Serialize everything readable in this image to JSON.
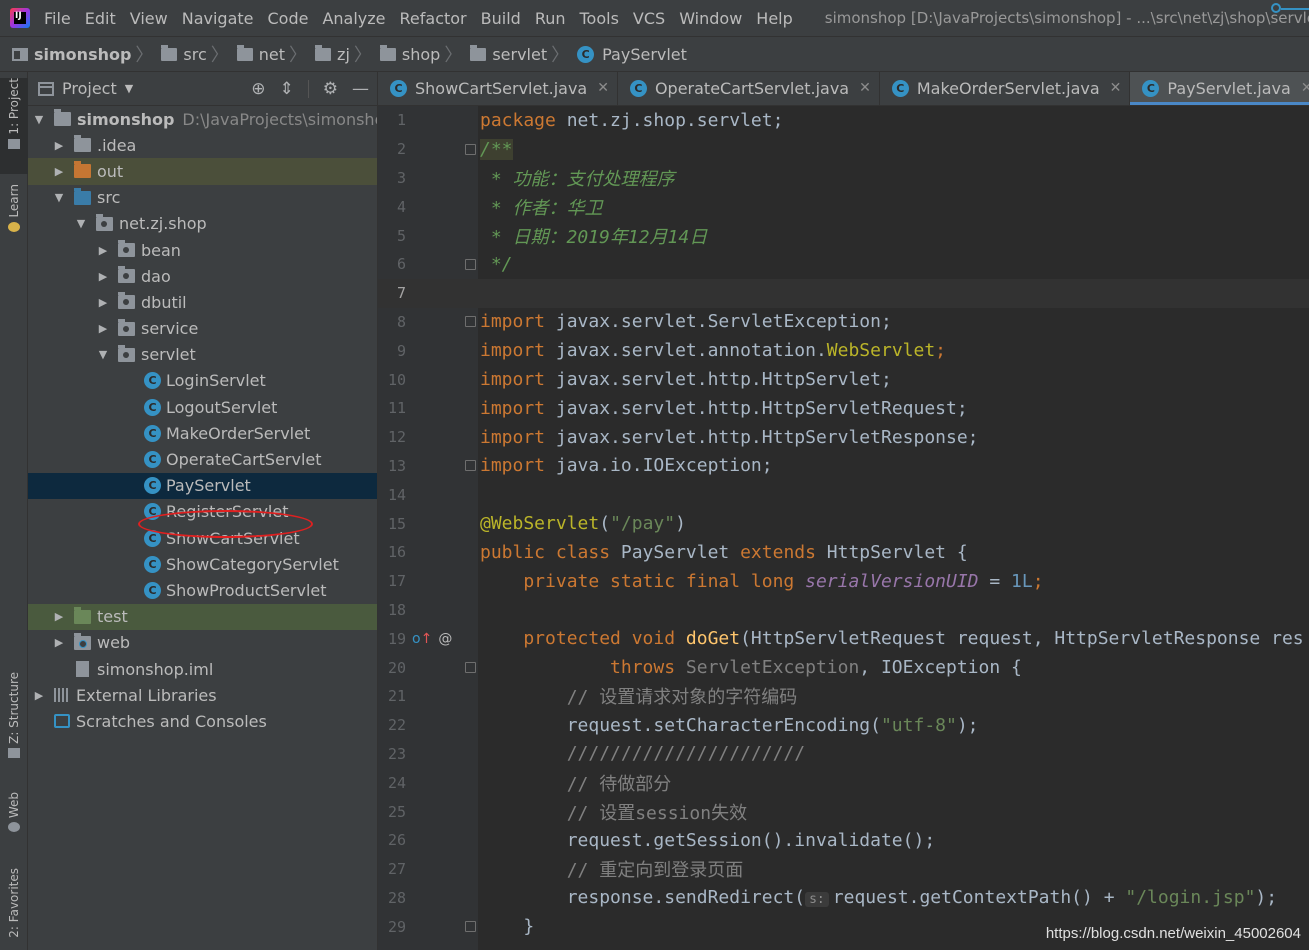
{
  "menu": {
    "items": [
      "File",
      "Edit",
      "View",
      "Navigate",
      "Code",
      "Analyze",
      "Refactor",
      "Build",
      "Run",
      "Tools",
      "VCS",
      "Window",
      "Help"
    ],
    "window_title": "simonshop [D:\\JavaProjects\\simonshop] - ...\\src\\net\\zj\\shop\\servlet\\"
  },
  "breadcrumb": {
    "items": [
      "simonshop",
      "src",
      "net",
      "zj",
      "shop",
      "servlet",
      "PayServlet"
    ]
  },
  "stripe": {
    "project": "1: Project",
    "learn": "Learn",
    "structure": "Z: Structure",
    "web": "Web",
    "favorites": "2: Favorites"
  },
  "project_panel": {
    "title": "Project",
    "tree": {
      "root": "simonshop",
      "root_path": "D:\\JavaProjects\\simonshop",
      "idea": ".idea",
      "out": "out",
      "src": "src",
      "package": "net.zj.shop",
      "bean": "bean",
      "dao": "dao",
      "dbutil": "dbutil",
      "service": "service",
      "servlet": "servlet",
      "servlets": [
        "LoginServlet",
        "LogoutServlet",
        "MakeOrderServlet",
        "OperateCartServlet",
        "PayServlet",
        "RegisterServlet",
        "ShowCartServlet",
        "ShowCategoryServlet",
        "ShowProductServlet"
      ],
      "test": "test",
      "web": "web",
      "iml": "simonshop.iml",
      "ext_libs": "External Libraries",
      "scratches": "Scratches and Consoles"
    }
  },
  "editor": {
    "tabs": [
      "ShowCartServlet.java",
      "OperateCartServlet.java",
      "MakeOrderServlet.java",
      "PayServlet.java"
    ],
    "active_tab": "PayServlet.java",
    "line_numbers": [
      "1",
      "2",
      "3",
      "4",
      "5",
      "6",
      "7",
      "8",
      "9",
      "10",
      "11",
      "12",
      "13",
      "14",
      "15",
      "16",
      "17",
      "18",
      "19",
      "20",
      "21",
      "22",
      "23",
      "24",
      "25",
      "26",
      "27",
      "28",
      "29"
    ],
    "code": {
      "l1_kw": "package",
      "l1": " net.zj.shop.servlet;",
      "l2": "/**",
      "l3": " * 功能：支付处理程序",
      "l4": " * 作者：华卫",
      "l5": " * 日期：2019年12月14日",
      "l6": " */",
      "imp": "import",
      "l8": " javax.servlet.ServletException;",
      "l9a": " javax.servlet.annotation.",
      "l9b": "WebServlet",
      "l9c": ";",
      "l10": " javax.servlet.http.HttpServlet;",
      "l11": " javax.servlet.http.HttpServletRequest;",
      "l12": " javax.servlet.http.HttpServletResponse;",
      "l13": " java.io.IOException;",
      "l15a": "@WebServlet",
      "l15b": "(",
      "l15c": "\"/pay\"",
      "l15d": ")",
      "l16a": "public class",
      "l16b": " PayServlet ",
      "l16c": "extends",
      "l16d": " HttpServlet {",
      "l17a": "    private static final long ",
      "l17b": "serialVersionUID",
      "l17c": " = ",
      "l17d": "1L",
      "l17e": ";",
      "l19a": "    protected void ",
      "l19b": "doGet",
      "l19c": "(HttpServletRequest request, HttpServletResponse res",
      "l20a": "            throws ",
      "l20b": "ServletException",
      "l20c": ", IOException {",
      "l21": "        // 设置请求对象的字符编码",
      "l22a": "        request.setCharacterEncoding(",
      "l22b": "\"utf-8\"",
      "l22c": ");",
      "l23": "        //////////////////////",
      "l24": "        // 待做部分",
      "l25": "        // 设置session失效",
      "l26": "        request.getSession().invalidate();",
      "l27": "        // 重定向到登录页面",
      "l28a": "        response.sendRedirect(",
      "l28hint": "s:",
      "l28b": "request.getContextPath() + ",
      "l28c": "\"/login.jsp\"",
      "l28d": ");",
      "l29": "    }"
    }
  },
  "watermark": "https://blog.csdn.net/weixin_45002604",
  "colors": {
    "background": "#2b2b2b",
    "panel": "#3c3f41",
    "accent": "#3592c4",
    "keyword": "#cc7832",
    "string": "#6a8759",
    "annotation": "#bbb529",
    "highlight_circle": "#e02020"
  }
}
